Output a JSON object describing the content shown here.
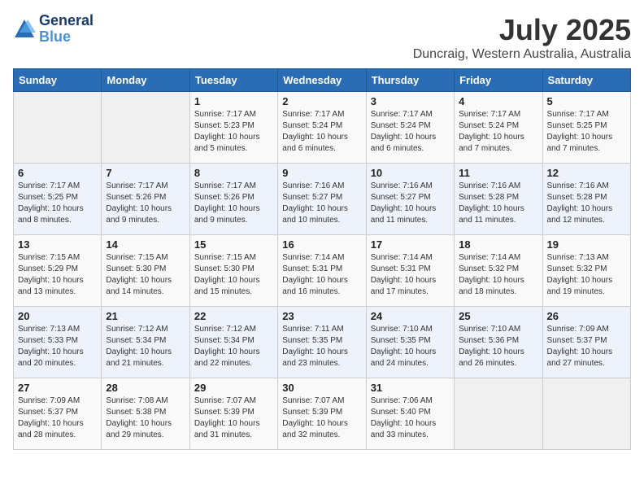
{
  "logo": {
    "line1": "General",
    "line2": "Blue"
  },
  "title": "July 2025",
  "location": "Duncraig, Western Australia, Australia",
  "headers": [
    "Sunday",
    "Monday",
    "Tuesday",
    "Wednesday",
    "Thursday",
    "Friday",
    "Saturday"
  ],
  "weeks": [
    [
      {
        "day": "",
        "info": ""
      },
      {
        "day": "",
        "info": ""
      },
      {
        "day": "1",
        "info": "Sunrise: 7:17 AM\nSunset: 5:23 PM\nDaylight: 10 hours\nand 5 minutes."
      },
      {
        "day": "2",
        "info": "Sunrise: 7:17 AM\nSunset: 5:24 PM\nDaylight: 10 hours\nand 6 minutes."
      },
      {
        "day": "3",
        "info": "Sunrise: 7:17 AM\nSunset: 5:24 PM\nDaylight: 10 hours\nand 6 minutes."
      },
      {
        "day": "4",
        "info": "Sunrise: 7:17 AM\nSunset: 5:24 PM\nDaylight: 10 hours\nand 7 minutes."
      },
      {
        "day": "5",
        "info": "Sunrise: 7:17 AM\nSunset: 5:25 PM\nDaylight: 10 hours\nand 7 minutes."
      }
    ],
    [
      {
        "day": "6",
        "info": "Sunrise: 7:17 AM\nSunset: 5:25 PM\nDaylight: 10 hours\nand 8 minutes."
      },
      {
        "day": "7",
        "info": "Sunrise: 7:17 AM\nSunset: 5:26 PM\nDaylight: 10 hours\nand 9 minutes."
      },
      {
        "day": "8",
        "info": "Sunrise: 7:17 AM\nSunset: 5:26 PM\nDaylight: 10 hours\nand 9 minutes."
      },
      {
        "day": "9",
        "info": "Sunrise: 7:16 AM\nSunset: 5:27 PM\nDaylight: 10 hours\nand 10 minutes."
      },
      {
        "day": "10",
        "info": "Sunrise: 7:16 AM\nSunset: 5:27 PM\nDaylight: 10 hours\nand 11 minutes."
      },
      {
        "day": "11",
        "info": "Sunrise: 7:16 AM\nSunset: 5:28 PM\nDaylight: 10 hours\nand 11 minutes."
      },
      {
        "day": "12",
        "info": "Sunrise: 7:16 AM\nSunset: 5:28 PM\nDaylight: 10 hours\nand 12 minutes."
      }
    ],
    [
      {
        "day": "13",
        "info": "Sunrise: 7:15 AM\nSunset: 5:29 PM\nDaylight: 10 hours\nand 13 minutes."
      },
      {
        "day": "14",
        "info": "Sunrise: 7:15 AM\nSunset: 5:30 PM\nDaylight: 10 hours\nand 14 minutes."
      },
      {
        "day": "15",
        "info": "Sunrise: 7:15 AM\nSunset: 5:30 PM\nDaylight: 10 hours\nand 15 minutes."
      },
      {
        "day": "16",
        "info": "Sunrise: 7:14 AM\nSunset: 5:31 PM\nDaylight: 10 hours\nand 16 minutes."
      },
      {
        "day": "17",
        "info": "Sunrise: 7:14 AM\nSunset: 5:31 PM\nDaylight: 10 hours\nand 17 minutes."
      },
      {
        "day": "18",
        "info": "Sunrise: 7:14 AM\nSunset: 5:32 PM\nDaylight: 10 hours\nand 18 minutes."
      },
      {
        "day": "19",
        "info": "Sunrise: 7:13 AM\nSunset: 5:32 PM\nDaylight: 10 hours\nand 19 minutes."
      }
    ],
    [
      {
        "day": "20",
        "info": "Sunrise: 7:13 AM\nSunset: 5:33 PM\nDaylight: 10 hours\nand 20 minutes."
      },
      {
        "day": "21",
        "info": "Sunrise: 7:12 AM\nSunset: 5:34 PM\nDaylight: 10 hours\nand 21 minutes."
      },
      {
        "day": "22",
        "info": "Sunrise: 7:12 AM\nSunset: 5:34 PM\nDaylight: 10 hours\nand 22 minutes."
      },
      {
        "day": "23",
        "info": "Sunrise: 7:11 AM\nSunset: 5:35 PM\nDaylight: 10 hours\nand 23 minutes."
      },
      {
        "day": "24",
        "info": "Sunrise: 7:10 AM\nSunset: 5:35 PM\nDaylight: 10 hours\nand 24 minutes."
      },
      {
        "day": "25",
        "info": "Sunrise: 7:10 AM\nSunset: 5:36 PM\nDaylight: 10 hours\nand 26 minutes."
      },
      {
        "day": "26",
        "info": "Sunrise: 7:09 AM\nSunset: 5:37 PM\nDaylight: 10 hours\nand 27 minutes."
      }
    ],
    [
      {
        "day": "27",
        "info": "Sunrise: 7:09 AM\nSunset: 5:37 PM\nDaylight: 10 hours\nand 28 minutes."
      },
      {
        "day": "28",
        "info": "Sunrise: 7:08 AM\nSunset: 5:38 PM\nDaylight: 10 hours\nand 29 minutes."
      },
      {
        "day": "29",
        "info": "Sunrise: 7:07 AM\nSunset: 5:39 PM\nDaylight: 10 hours\nand 31 minutes."
      },
      {
        "day": "30",
        "info": "Sunrise: 7:07 AM\nSunset: 5:39 PM\nDaylight: 10 hours\nand 32 minutes."
      },
      {
        "day": "31",
        "info": "Sunrise: 7:06 AM\nSunset: 5:40 PM\nDaylight: 10 hours\nand 33 minutes."
      },
      {
        "day": "",
        "info": ""
      },
      {
        "day": "",
        "info": ""
      }
    ]
  ],
  "colors": {
    "header_bg": "#2a6db5",
    "odd_row": "#f9f9f9",
    "even_row": "#eef3fb",
    "empty_cell": "#f0f0f0"
  }
}
